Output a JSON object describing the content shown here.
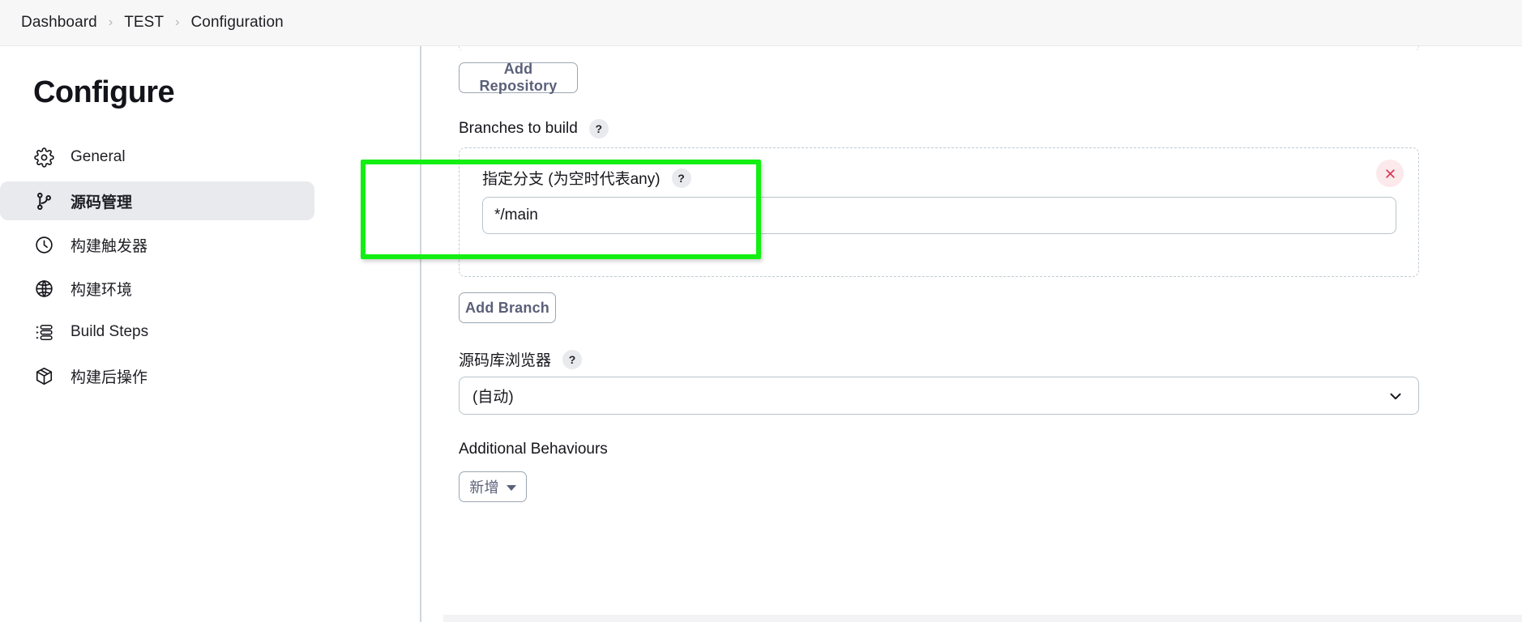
{
  "breadcrumb": {
    "separator": "›",
    "items": [
      {
        "label": "Dashboard"
      },
      {
        "label": "TEST"
      },
      {
        "label": "Configuration"
      }
    ]
  },
  "sidebar": {
    "title": "Configure",
    "items": [
      {
        "label": "General",
        "icon": "gear-icon",
        "active": false
      },
      {
        "label": "源码管理",
        "icon": "git-branch-icon",
        "active": true
      },
      {
        "label": "构建触发器",
        "icon": "clock-icon",
        "active": false
      },
      {
        "label": "构建环境",
        "icon": "globe-icon",
        "active": false
      },
      {
        "label": "Build Steps",
        "icon": "list-steps-icon",
        "active": false
      },
      {
        "label": "构建后操作",
        "icon": "package-icon",
        "active": false
      }
    ]
  },
  "main": {
    "add_repository_label": "Add Repository",
    "branches_label": "Branches to build",
    "branches_help": "?",
    "branch_row": {
      "field_label": "指定分支 (为空时代表any)",
      "field_help": "?",
      "value": "*/main",
      "placeholder": "",
      "delete_icon": "close-icon"
    },
    "add_branch_label": "Add Branch",
    "browser_label": "源码库浏览器",
    "browser_help": "?",
    "browser_value": "(自动)",
    "browser_chevron_icon": "chevron-down-icon",
    "behaviours_label": "Additional Behaviours",
    "add_behaviour_label": "新增"
  },
  "annotation": {
    "highlight_color": "#13ef13"
  },
  "colors": {
    "breadcrumb_bg": "#f7f7f8",
    "sidebar_active_bg": "#e9eaee",
    "button_border": "#9aa6b2",
    "button_text": "#5b6079",
    "delete_bg": "#fce9ec",
    "delete_fg": "#d93651",
    "dashed_border": "#c3ccd4",
    "input_border": "#b9c4cc"
  }
}
